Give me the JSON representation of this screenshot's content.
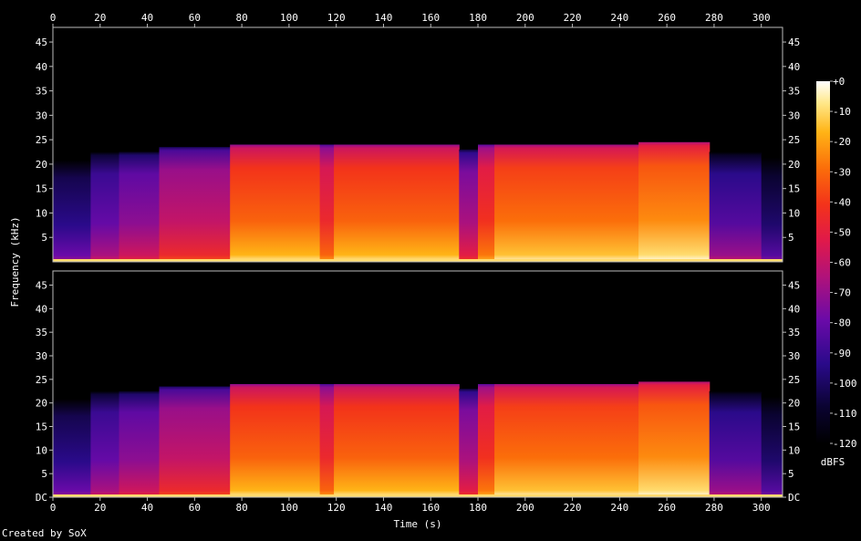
{
  "chart_data": {
    "type": "heatmap",
    "subtype": "spectrogram",
    "channels": 2,
    "xlabel": "Time (s)",
    "ylabel": "Frequency (kHz)",
    "xlim": [
      0,
      309
    ],
    "ylim_khz": [
      0,
      48
    ],
    "x_ticks": [
      0,
      20,
      40,
      60,
      80,
      100,
      120,
      140,
      160,
      180,
      200,
      220,
      240,
      260,
      280,
      300
    ],
    "y_tick_labels_top": [
      "5",
      "10",
      "15",
      "20",
      "25",
      "30",
      "35",
      "40",
      "45"
    ],
    "y_tick_labels_bottom": [
      "DC",
      "5",
      "10",
      "15",
      "20",
      "25",
      "30",
      "35",
      "40",
      "45"
    ],
    "colorbar": {
      "label": "dBFS",
      "range": [
        -120,
        0
      ],
      "tick_labels": [
        "+0",
        "-10",
        "-20",
        "-30",
        "-40",
        "-50",
        "-60",
        "-70",
        "-80",
        "-90",
        "-100",
        "-110",
        "-120"
      ]
    },
    "segments": [
      {
        "t": [
          0,
          16
        ],
        "cutoff_khz": 21.5,
        "level": 0.22
      },
      {
        "t": [
          16,
          28
        ],
        "cutoff_khz": 22.5,
        "level": 0.33
      },
      {
        "t": [
          28,
          45
        ],
        "cutoff_khz": 22.5,
        "level": 0.4
      },
      {
        "t": [
          45,
          75
        ],
        "cutoff_khz": 23.5,
        "level": 0.5
      },
      {
        "t": [
          75,
          113
        ],
        "cutoff_khz": 24,
        "level": 0.74
      },
      {
        "t": [
          113,
          119
        ],
        "cutoff_khz": 24,
        "level": 0.62
      },
      {
        "t": [
          119,
          172
        ],
        "cutoff_khz": 24,
        "level": 0.74
      },
      {
        "t": [
          172,
          180
        ],
        "cutoff_khz": 23,
        "level": 0.45
      },
      {
        "t": [
          180,
          187
        ],
        "cutoff_khz": 24,
        "level": 0.65
      },
      {
        "t": [
          187,
          248
        ],
        "cutoff_khz": 24,
        "level": 0.76
      },
      {
        "t": [
          248,
          278
        ],
        "cutoff_khz": 24.5,
        "level": 0.8
      },
      {
        "t": [
          278,
          300
        ],
        "cutoff_khz": 22.5,
        "level": 0.3
      },
      {
        "t": [
          300,
          309
        ],
        "cutoff_khz": 22,
        "level": 0.18
      }
    ]
  },
  "footer": {
    "credit": "Created by SoX"
  }
}
